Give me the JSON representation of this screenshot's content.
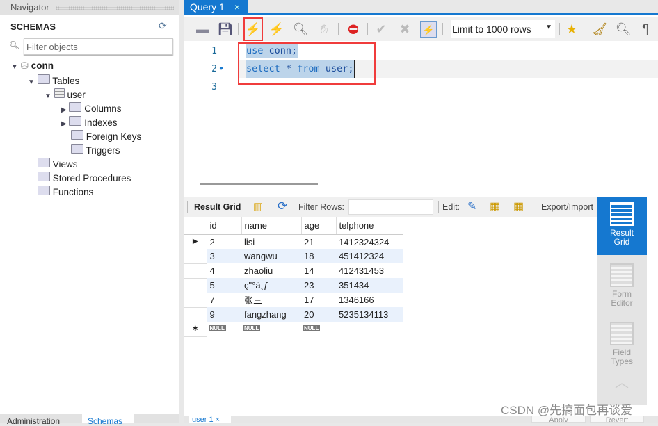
{
  "navigator": {
    "title": "Navigator",
    "schemas_label": "SCHEMAS",
    "filter_placeholder": "Filter objects",
    "tree": {
      "schema": "conn",
      "tables": "Tables",
      "table": "user",
      "columns": "Columns",
      "indexes": "Indexes",
      "foreign_keys": "Foreign Keys",
      "triggers": "Triggers",
      "views": "Views",
      "stored_procedures": "Stored Procedures",
      "functions": "Functions"
    },
    "bottom_tabs": [
      "Administration",
      "Schemas"
    ]
  },
  "query_tab": {
    "label": "Query 1",
    "close": "×"
  },
  "toolbar": {
    "limit_select": "Limit to 1000 rows"
  },
  "editor": {
    "lines": [
      {
        "n": "1",
        "kw": "use",
        "rest": " conn;"
      },
      {
        "n": "2",
        "kw": "select",
        "rest": " * ",
        "kw2": "from",
        "rest2": " user;"
      },
      {
        "n": "3"
      }
    ]
  },
  "result_toolbar": {
    "result_grid": "Result Grid",
    "filter_rows": "Filter Rows:",
    "filter_value": "",
    "edit": "Edit:",
    "export": "Export/Import"
  },
  "grid": {
    "columns": [
      "id",
      "name",
      "age",
      "telphone"
    ],
    "rows": [
      [
        "2",
        "lisi",
        "21",
        "1412324324"
      ],
      [
        "3",
        "wangwu",
        "18",
        "451412324"
      ],
      [
        "4",
        "zhaoliu",
        "14",
        "412431453"
      ],
      [
        "5",
        "ç\"°ä¸ƒ",
        "23",
        "351434"
      ],
      [
        "7",
        "张三",
        "17",
        "1346166"
      ],
      [
        "9",
        "fangzhang",
        "20",
        "5235134113"
      ]
    ],
    "null_label": "NULL"
  },
  "side_panel": [
    {
      "label": "Result\nGrid",
      "active": true
    },
    {
      "label": "Form\nEditor"
    },
    {
      "label": "Field\nTypes"
    }
  ],
  "bottom": {
    "result_tab": "user 1",
    "close": "×",
    "apply": "Apply",
    "revert": "Revert"
  },
  "watermark": "CSDN @先搞面包再谈爱",
  "colors": {
    "accent": "#1578d0",
    "highlight": "#f03c3c",
    "selection": "#bcd4ea"
  }
}
